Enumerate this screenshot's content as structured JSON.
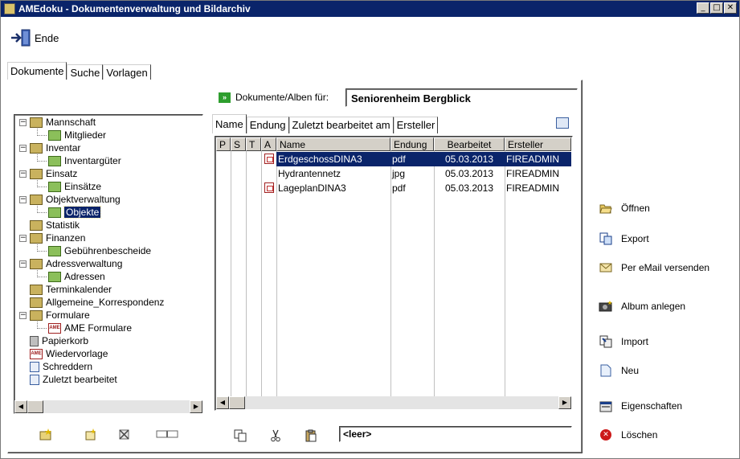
{
  "window": {
    "title": "AMEdoku - Dokumentenverwaltung und Bildarchiv",
    "controls": [
      "_",
      "□",
      "✕"
    ]
  },
  "toolbar": {
    "ende_label": "Ende"
  },
  "tabs": [
    {
      "label": "Dokumente",
      "active": true
    },
    {
      "label": "Suche",
      "active": false
    },
    {
      "label": "Vorlagen",
      "active": false
    }
  ],
  "docs_for": {
    "label": "Dokumente/Alben für:",
    "value": "Seniorenheim Bergblick"
  },
  "tree": {
    "items": [
      {
        "label": "Mannschaft",
        "level": 0,
        "icon": "folder-group-icon",
        "expander": "−"
      },
      {
        "label": "Mitglieder",
        "level": 1,
        "icon": "album-icon"
      },
      {
        "label": "Inventar",
        "level": 0,
        "icon": "folder-group-icon",
        "expander": "−"
      },
      {
        "label": "Inventargüter",
        "level": 1,
        "icon": "album-icon"
      },
      {
        "label": "Einsatz",
        "level": 0,
        "icon": "folder-group-icon",
        "expander": "−"
      },
      {
        "label": "Einsätze",
        "level": 1,
        "icon": "album-icon"
      },
      {
        "label": "Objektverwaltung",
        "level": 0,
        "icon": "folder-group-icon",
        "expander": "−"
      },
      {
        "label": "Objekte",
        "level": 1,
        "icon": "album-icon",
        "selected": true
      },
      {
        "label": "Statistik",
        "level": 0,
        "icon": "folder-group-icon"
      },
      {
        "label": "Finanzen",
        "level": 0,
        "icon": "folder-group-icon",
        "expander": "−"
      },
      {
        "label": "Gebührenbescheide",
        "level": 1,
        "icon": "album-icon"
      },
      {
        "label": "Adressverwaltung",
        "level": 0,
        "icon": "folder-group-icon",
        "expander": "−"
      },
      {
        "label": "Adressen",
        "level": 1,
        "icon": "album-icon"
      },
      {
        "label": "Terminkalender",
        "level": 0,
        "icon": "folder-group-icon"
      },
      {
        "label": "Allgemeine_Korrespondenz",
        "level": 0,
        "icon": "folder-group-icon"
      },
      {
        "label": "Formulare",
        "level": 0,
        "icon": "folder-group-icon",
        "expander": "−"
      },
      {
        "label": "AME Formulare",
        "level": 1,
        "icon": "ame-icon"
      },
      {
        "label": "Papierkorb",
        "level": 0,
        "icon": "trash-icon"
      },
      {
        "label": "Wiedervorlage",
        "level": 0,
        "icon": "ame-icon"
      },
      {
        "label": "Schreddern",
        "level": 0,
        "icon": "shredder-icon"
      },
      {
        "label": "Zuletzt bearbeitet",
        "level": 0,
        "icon": "recent-icon"
      }
    ]
  },
  "subtabs": [
    {
      "label": "Name",
      "active": true
    },
    {
      "label": "Endung",
      "active": false
    },
    {
      "label": "Zuletzt bearbeitet am",
      "active": false
    },
    {
      "label": "Ersteller",
      "active": false
    }
  ],
  "list": {
    "columns": [
      "P",
      "S",
      "T",
      "A",
      "Name",
      "Endung",
      "Bearbeitet",
      "Ersteller"
    ],
    "rows": [
      {
        "name": "ErdgeschossDINA3",
        "endung": "pdf",
        "bearbeitet": "05.03.2013",
        "ersteller": "FIREADMIN",
        "icon": "pdf-icon",
        "selected": true
      },
      {
        "name": "Hydrantennetz",
        "endung": "jpg",
        "bearbeitet": "05.03.2013",
        "ersteller": "FIREADMIN",
        "icon": "",
        "selected": false
      },
      {
        "name": "LageplanDINA3",
        "endung": "pdf",
        "bearbeitet": "05.03.2013",
        "ersteller": "FIREADMIN",
        "icon": "pdf-icon",
        "selected": false
      }
    ]
  },
  "clipboard_field": "<leer>",
  "actions": [
    {
      "label": "Öffnen",
      "icon": "open-folder-icon"
    },
    {
      "label": "Export",
      "icon": "export-icon"
    },
    {
      "label": "Per eMail versenden",
      "icon": "email-icon"
    },
    {
      "label": "Album anlegen",
      "icon": "camera-icon"
    },
    {
      "label": "Import",
      "icon": "import-icon"
    },
    {
      "label": "Neu",
      "icon": "new-document-icon"
    },
    {
      "label": "Eigenschaften",
      "icon": "properties-icon"
    },
    {
      "label": "Löschen",
      "icon": "delete-icon"
    }
  ],
  "colors": {
    "titlebar": "#0a246a",
    "selection": "#0a246a"
  }
}
